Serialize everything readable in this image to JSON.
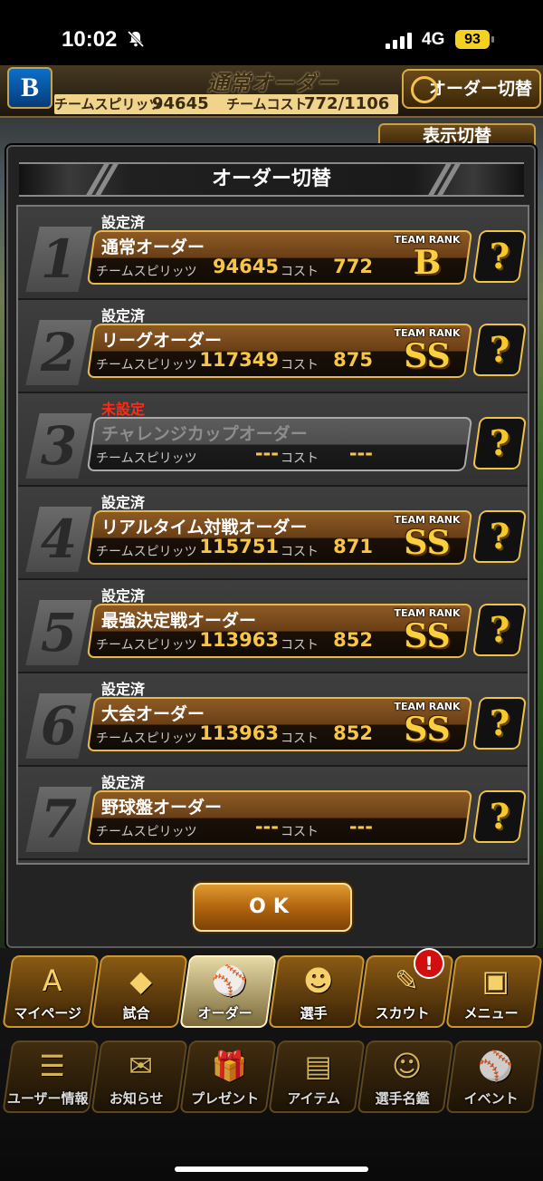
{
  "status_bar": {
    "time": "10:02",
    "network": "4G",
    "battery": "93"
  },
  "header": {
    "logo_letter": "B",
    "title": "通常オーダー",
    "spirits_label": "チームスピリッツ",
    "spirits_value": "94645",
    "cost_label": "チームコスト",
    "cost_value": "772/1106",
    "order_switch_label": "オーダー切替",
    "display_switch_label": "表示切替"
  },
  "dialog": {
    "title": "オーダー切替",
    "spirits_label": "チームスピリッツ",
    "cost_label": "コスト",
    "rank_label": "TEAM RANK",
    "help_label": "?",
    "orders": [
      {
        "number": "1",
        "state": "設定済",
        "name": "通常オーダー",
        "spirits": "94645",
        "cost": "772",
        "rank": "B"
      },
      {
        "number": "2",
        "state": "設定済",
        "name": "リーグオーダー",
        "spirits": "117349",
        "cost": "875",
        "rank": "SS"
      },
      {
        "number": "3",
        "state": "未設定",
        "name": "チャレンジカップオーダー",
        "spirits": "---",
        "cost": "---",
        "rank": ""
      },
      {
        "number": "4",
        "state": "設定済",
        "name": "リアルタイム対戦オーダー",
        "spirits": "115751",
        "cost": "871",
        "rank": "SS"
      },
      {
        "number": "5",
        "state": "設定済",
        "name": "最強決定戦オーダー",
        "spirits": "113963",
        "cost": "852",
        "rank": "SS"
      },
      {
        "number": "6",
        "state": "設定済",
        "name": "大会オーダー",
        "spirits": "113963",
        "cost": "852",
        "rank": "SS"
      },
      {
        "number": "7",
        "state": "設定済",
        "name": "野球盤オーダー",
        "spirits": "---",
        "cost": "---",
        "rank": ""
      }
    ],
    "ok_label": "OK"
  },
  "nav_row1": [
    {
      "label": "マイページ",
      "icon": "A"
    },
    {
      "label": "試合",
      "icon": "◆"
    },
    {
      "label": "オーダー",
      "icon": "⚾"
    },
    {
      "label": "選手",
      "icon": "☻"
    },
    {
      "label": "スカウト",
      "icon": "✎"
    },
    {
      "label": "メニュー",
      "icon": "▣"
    }
  ],
  "nav_row2": [
    {
      "label": "ユーザー情報",
      "icon": "☰"
    },
    {
      "label": "お知らせ",
      "icon": "✉"
    },
    {
      "label": "プレゼント",
      "icon": "🎁"
    },
    {
      "label": "アイテム",
      "icon": "▤"
    },
    {
      "label": "選手名鑑",
      "icon": "☺"
    },
    {
      "label": "イベント",
      "icon": "⚾"
    }
  ],
  "scout_badge": "!"
}
